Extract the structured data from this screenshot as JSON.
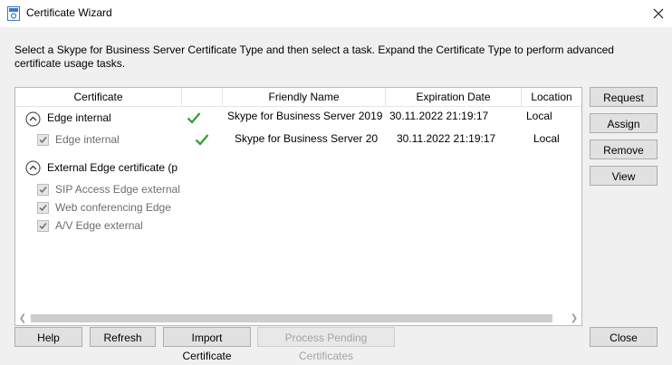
{
  "window": {
    "title": "Certificate Wizard",
    "close_glyph": "✕"
  },
  "instructions": "Select a Skype for Business Server Certificate Type and then select a task. Expand the Certificate Type to perform advanced certificate usage tasks.",
  "table": {
    "columns": [
      "Certificate",
      "Friendly Name",
      "Expiration Date",
      "Location"
    ],
    "groups": [
      {
        "name": "Edge internal",
        "friendly_name": "Skype for Business Server 2019",
        "expiration": "30.11.2022 21:19:17",
        "location": "Local",
        "assigned": true,
        "items": [
          {
            "name": "Edge internal",
            "friendly_name": "Skype for Business Server 20",
            "expiration": "30.11.2022 21:19:17",
            "location": "Local",
            "assigned": true
          }
        ]
      },
      {
        "name": "External Edge certificate (p",
        "items": [
          {
            "name": "SIP Access Edge external"
          },
          {
            "name": "Web conferencing Edge"
          },
          {
            "name": "A/V Edge external"
          }
        ]
      }
    ]
  },
  "side_buttons": {
    "request": "Request",
    "assign": "Assign",
    "remove": "Remove",
    "view": "View"
  },
  "bottom_buttons": {
    "help": "Help",
    "refresh": "Refresh",
    "import": "Import Certificate",
    "process": "Process Pending Certificates",
    "close": "Close"
  },
  "icons": {
    "app": "certificate-icon",
    "expand": "collapse-circle-icon",
    "assigned": "green-checkmark-icon",
    "checkbox": "checked-checkbox-icon"
  },
  "colors": {
    "checkmark": "#2e9e2e",
    "accent": "#0b63b8"
  }
}
